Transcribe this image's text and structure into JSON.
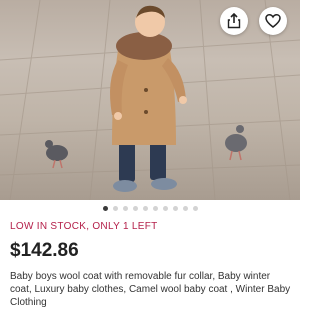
{
  "listing": {
    "image": {
      "alt": "",
      "carousel_dots": 10,
      "active_dot": 0
    },
    "actions": {
      "share_icon": "share-icon",
      "favorite_icon": "heart-outline-icon"
    },
    "stock_text": "LOW IN STOCK, ONLY 1 LEFT",
    "price": "$142.86",
    "title": "Baby boys wool coat with removable fur collar, Baby winter coat, Luxury baby clothes, Camel wool baby coat , Winter Baby Clothing"
  },
  "colors": {
    "stock_text": "#b4204a",
    "price": "#222222",
    "coat": "#c99a6a",
    "fur_collar": "#8a5f44"
  }
}
